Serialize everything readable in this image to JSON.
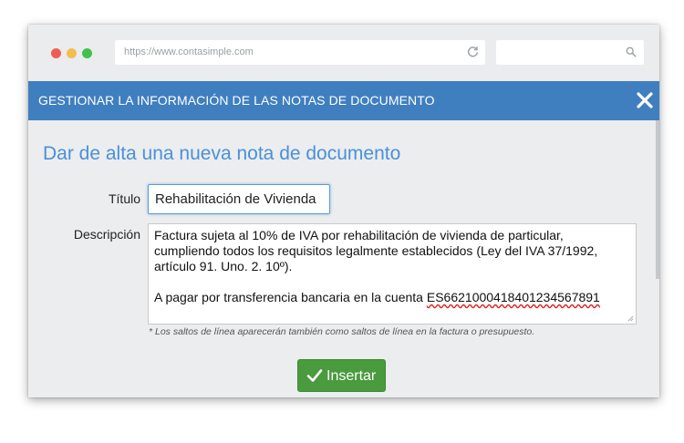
{
  "browser": {
    "url": "https://www.contasimple.com",
    "icons": {
      "reload": "reload-icon",
      "search": "search-icon"
    },
    "dots": [
      "#ee5e56",
      "#f5bd4f",
      "#3fc24e"
    ]
  },
  "modal": {
    "title": "GESTIONAR LA INFORMACIÓN DE LAS NOTAS DE DOCUMENTO",
    "header_color": "#3f7fbf",
    "close_icon": "close-icon"
  },
  "form": {
    "heading": "Dar de alta una nueva nota de documento",
    "title_label": "Título",
    "title_value": "Rehabilitación de Vivienda",
    "description_label": "Descripción",
    "description_lines": [
      "Factura sujeta al 10% de IVA por rehabilitación de vivienda de particular,",
      "cumpliendo todos los requisitos legalmente establecidos (Ley del IVA 37/1992,",
      "artículo 91. Uno. 2. 10º).",
      "",
      "A pagar por transferencia bancaria en la cuenta "
    ],
    "iban": "ES6621000418401234567891",
    "note": "* Los saltos de línea aparecerán también como saltos de línea en la factura o presupuesto.",
    "submit_label": "Insertar",
    "submit_color": "#4a9a3e",
    "accent_color": "#4a90d9"
  }
}
